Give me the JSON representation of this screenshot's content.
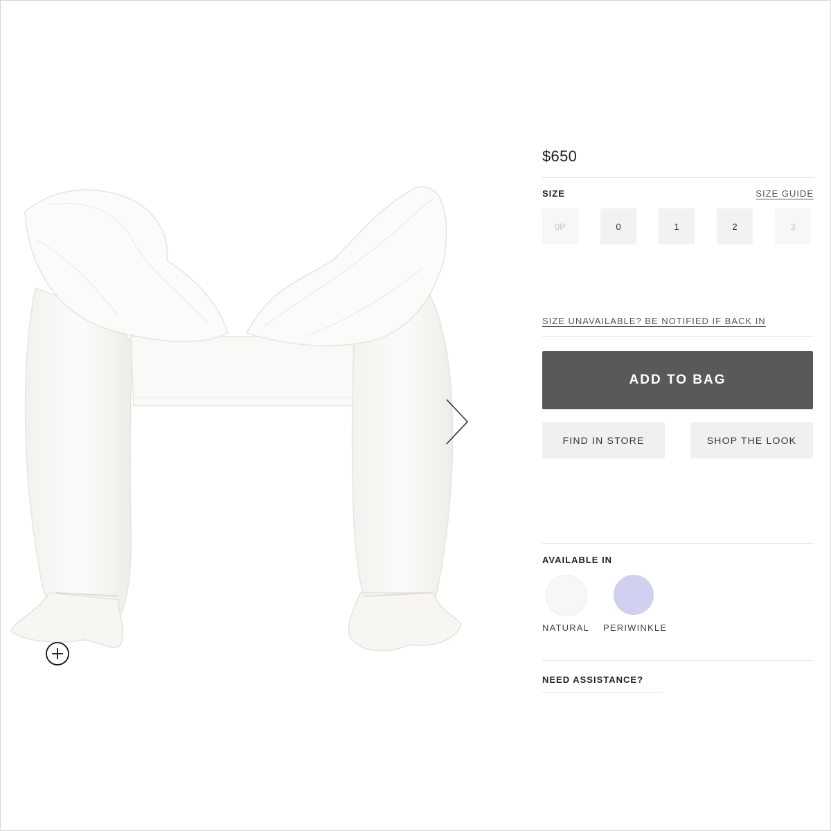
{
  "product": {
    "price": "$650",
    "image_alt": "White organza off-shoulder ruffle top with balloon sleeves"
  },
  "size": {
    "label": "SIZE",
    "guide_link": "SIZE GUIDE",
    "options": [
      {
        "label": "0P",
        "available": false
      },
      {
        "label": "0",
        "available": true
      },
      {
        "label": "1",
        "available": true
      },
      {
        "label": "2",
        "available": true
      },
      {
        "label": "3",
        "available": false
      }
    ],
    "unavailable_link": "SIZE UNAVAILABLE? BE NOTIFIED IF BACK IN"
  },
  "actions": {
    "add_to_bag": "ADD TO BAG",
    "find_in_store": "FIND IN STORE",
    "shop_the_look": "SHOP THE LOOK"
  },
  "colors": {
    "label": "AVAILABLE IN",
    "options": [
      {
        "name": "NATURAL",
        "swatch": "#f6f7f8"
      },
      {
        "name": "PERIWINKLE",
        "swatch": "#d2d0f0"
      }
    ]
  },
  "assistance": {
    "label": "NEED ASSISTANCE?"
  },
  "icons": {
    "next": "chevron-right-icon",
    "zoom": "plus-circle-icon"
  },
  "theme": {
    "primary_button": "#595959",
    "secondary_button": "#f0f0f0"
  }
}
